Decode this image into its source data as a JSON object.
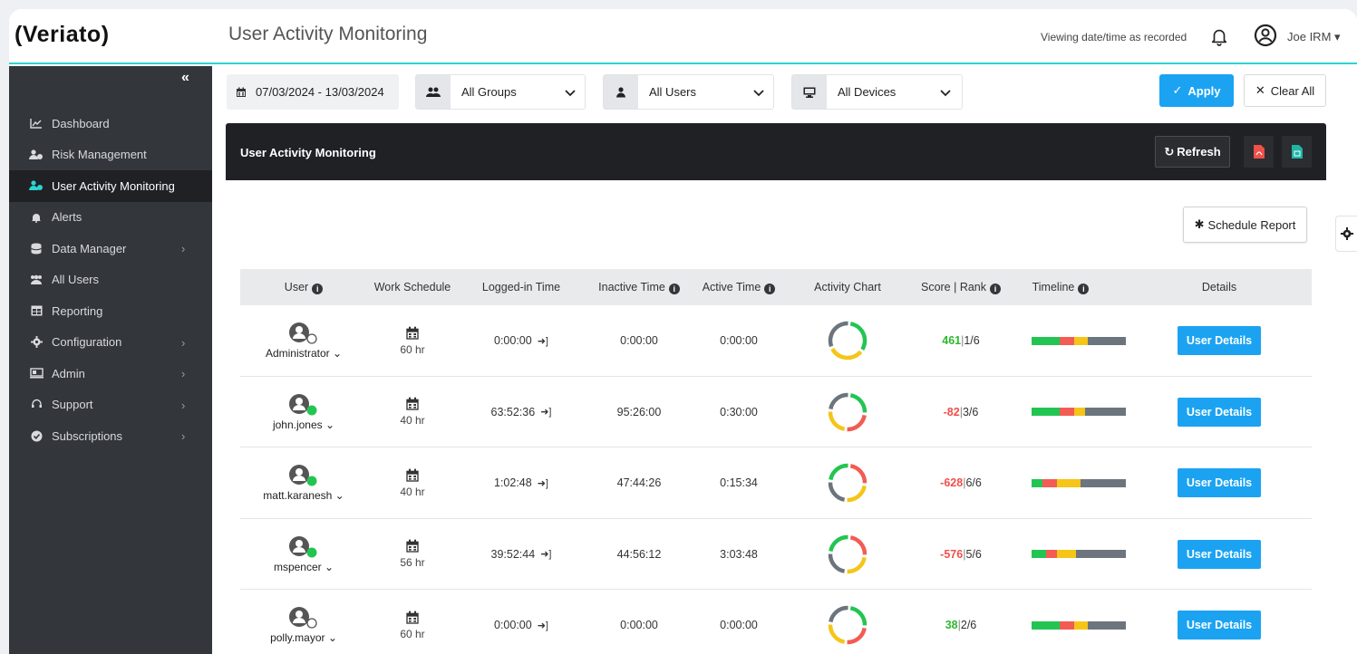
{
  "app": {
    "logo": "(Veriato)",
    "page_title": "User Activity Monitoring",
    "viewing_note": "Viewing date/time as recorded",
    "user_name": "Joe IRM",
    "user_caret": "▾"
  },
  "sidebar": {
    "collapse_label": "«",
    "items": [
      {
        "label": "Dashboard",
        "icon": "chart-line-icon",
        "chevron": false,
        "active": false
      },
      {
        "label": "Risk Management",
        "icon": "user-shield-icon",
        "chevron": false,
        "active": false
      },
      {
        "label": "User Activity Monitoring",
        "icon": "user-activity-icon",
        "chevron": false,
        "active": true
      },
      {
        "label": "Alerts",
        "icon": "bell-icon",
        "chevron": false,
        "active": false
      },
      {
        "label": "Data Manager",
        "icon": "database-icon",
        "chevron": true,
        "active": false
      },
      {
        "label": "All Users",
        "icon": "users-icon",
        "chevron": false,
        "active": false
      },
      {
        "label": "Reporting",
        "icon": "table-icon",
        "chevron": false,
        "active": false
      },
      {
        "label": "Configuration",
        "icon": "gear-icon",
        "chevron": true,
        "active": false
      },
      {
        "label": "Admin",
        "icon": "admin-icon",
        "chevron": true,
        "active": false
      },
      {
        "label": "Support",
        "icon": "headset-icon",
        "chevron": true,
        "active": false
      },
      {
        "label": "Subscriptions",
        "icon": "check-circle-icon",
        "chevron": true,
        "active": false
      }
    ]
  },
  "filters": {
    "date_range": "07/03/2024 - 13/03/2024",
    "groups": "All Groups",
    "users": "All Users",
    "devices": "All Devices",
    "apply_label": "Apply",
    "clear_label": "Clear All"
  },
  "panel": {
    "title": "User Activity Monitoring",
    "refresh_label": "Refresh",
    "schedule_label": "Schedule Report"
  },
  "table": {
    "headers": [
      "User",
      "Work Schedule",
      "Logged-in Time",
      "Inactive Time",
      "Active Time",
      "Activity Chart",
      "Score | Rank",
      "Timeline",
      "Details"
    ],
    "details_label": "User Details",
    "rows": [
      {
        "user": "Administrator",
        "online": false,
        "schedule": "60 hr",
        "logged_in": "0:00:00",
        "inactive": "0:00:00",
        "active": "0:00:00",
        "score": "461",
        "rank": "1/6",
        "score_color": "#2eb82e",
        "ring": [
          "#23c552",
          "#f5c518",
          "#6c757d"
        ],
        "timeline": [
          [
            "#23c552",
            0.3
          ],
          [
            "#f25c54",
            0.15
          ],
          [
            "#f5c518",
            0.15
          ],
          [
            "#6c757d",
            0.4
          ]
        ]
      },
      {
        "user": "john.jones",
        "online": true,
        "schedule": "40 hr",
        "logged_in": "63:52:36",
        "inactive": "95:26:00",
        "active": "0:30:00",
        "score": "-82",
        "rank": "3/6",
        "score_color": "#f0504a",
        "ring": [
          "#23c552",
          "#f25c54",
          "#f5c518",
          "#6c757d"
        ],
        "timeline": [
          [
            "#23c552",
            0.3
          ],
          [
            "#f25c54",
            0.15
          ],
          [
            "#f5c518",
            0.12
          ],
          [
            "#6c757d",
            0.43
          ]
        ]
      },
      {
        "user": "matt.karanesh",
        "online": true,
        "schedule": "40 hr",
        "logged_in": "1:02:48",
        "inactive": "47:44:26",
        "active": "0:15:34",
        "score": "-628",
        "rank": "6/6",
        "score_color": "#f0504a",
        "ring": [
          "#f25c54",
          "#f5c518",
          "#6c757d",
          "#23c552"
        ],
        "timeline": [
          [
            "#23c552",
            0.12
          ],
          [
            "#f25c54",
            0.15
          ],
          [
            "#f5c518",
            0.25
          ],
          [
            "#6c757d",
            0.48
          ]
        ]
      },
      {
        "user": "mspencer",
        "online": true,
        "schedule": "56 hr",
        "logged_in": "39:52:44",
        "inactive": "44:56:12",
        "active": "3:03:48",
        "score": "-576",
        "rank": "5/6",
        "score_color": "#f0504a",
        "ring": [
          "#f25c54",
          "#f5c518",
          "#6c757d",
          "#23c552"
        ],
        "timeline": [
          [
            "#23c552",
            0.15
          ],
          [
            "#f25c54",
            0.12
          ],
          [
            "#f5c518",
            0.2
          ],
          [
            "#6c757d",
            0.53
          ]
        ]
      },
      {
        "user": "polly.mayor",
        "online": false,
        "schedule": "60 hr",
        "logged_in": "0:00:00",
        "inactive": "0:00:00",
        "active": "0:00:00",
        "score": "38",
        "rank": "2/6",
        "score_color": "#2eb82e",
        "ring": [
          "#23c552",
          "#f25c54",
          "#f5c518",
          "#6c757d"
        ],
        "timeline": [
          [
            "#23c552",
            0.3
          ],
          [
            "#f25c54",
            0.15
          ],
          [
            "#f5c518",
            0.15
          ],
          [
            "#6c757d",
            0.4
          ]
        ]
      }
    ]
  },
  "colors": {
    "accent": "#1ba3f2",
    "sidebar_bg": "#33363a",
    "header_bg": "#1f2124",
    "topbar_border": "#2ed3d3"
  }
}
